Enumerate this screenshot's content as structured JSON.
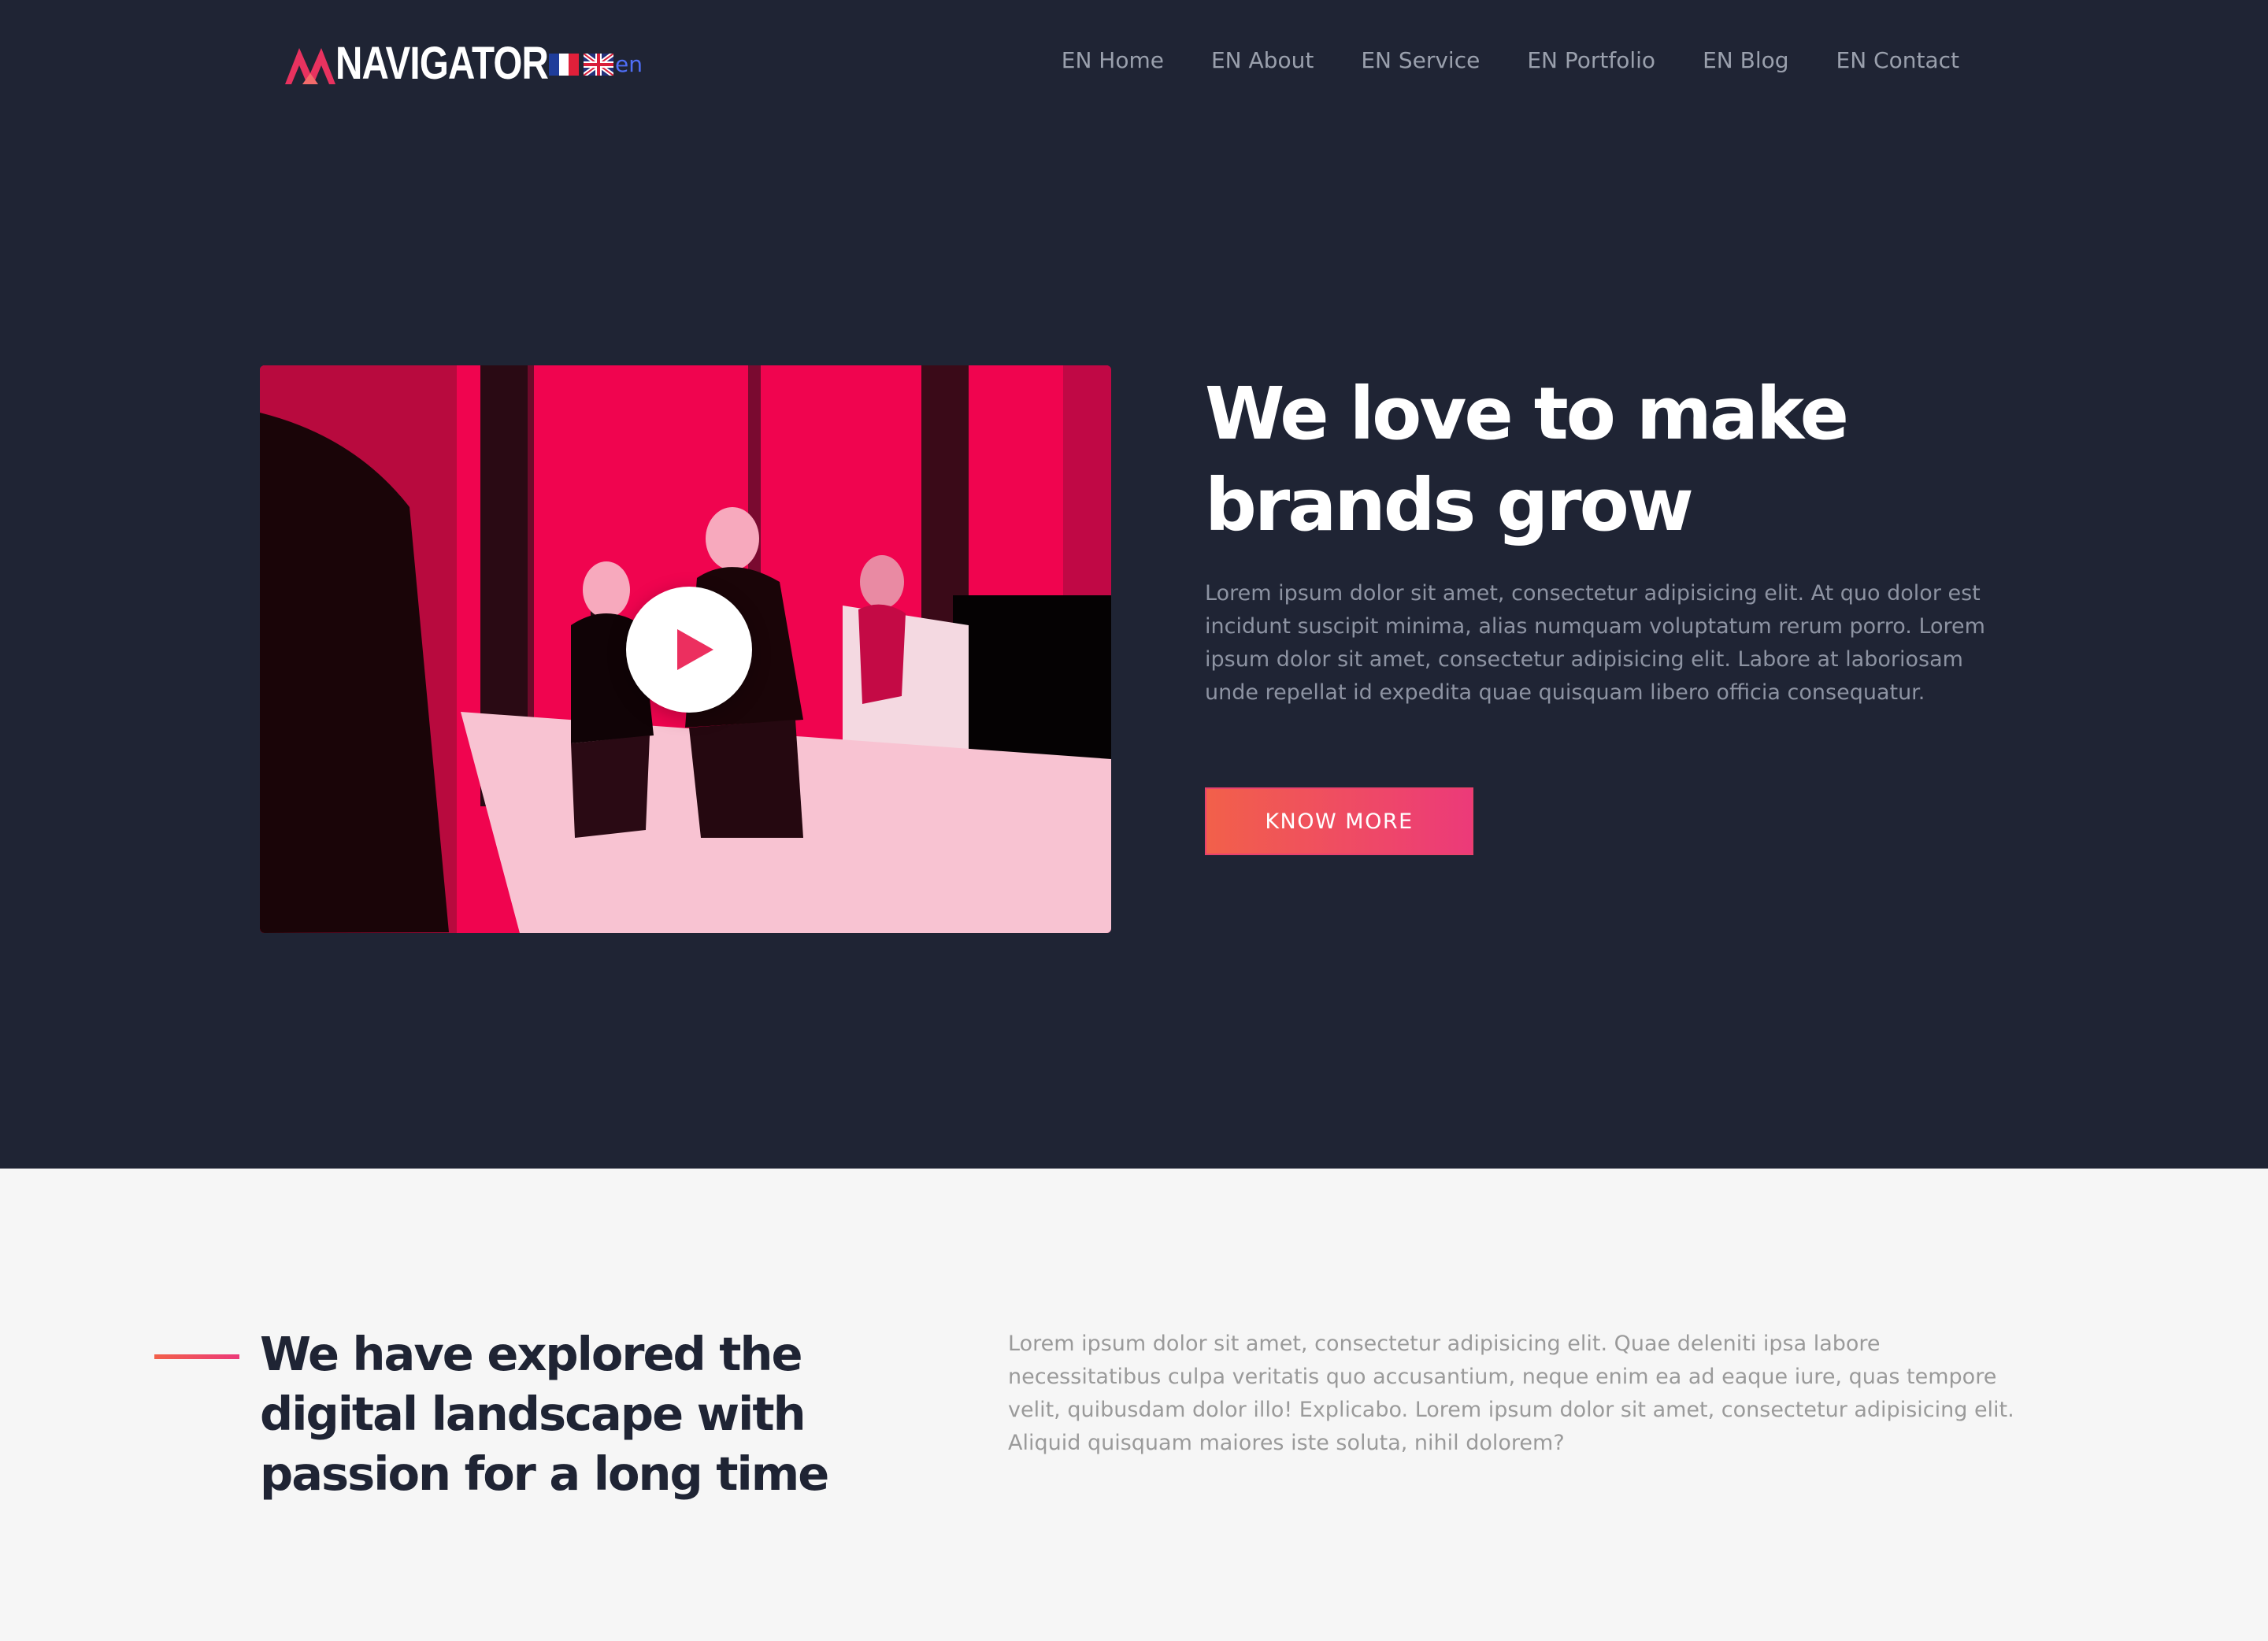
{
  "brand": {
    "name": "NAVIGATOR",
    "accent_color": "#ec2f5f",
    "logo_icon": "navigator-logo-icon"
  },
  "language": {
    "flags": [
      "french-flag-icon",
      "uk-flag-icon"
    ],
    "current": "en"
  },
  "nav": {
    "items": [
      {
        "label": "EN Home"
      },
      {
        "label": "EN About"
      },
      {
        "label": "EN Service"
      },
      {
        "label": "EN Portfolio"
      },
      {
        "label": "EN Blog"
      },
      {
        "label": "EN Contact"
      }
    ]
  },
  "hero": {
    "title": "We love to make brands grow",
    "text": "Lorem ipsum dolor sit amet, consectetur adipisicing elit. At quo dolor est incidunt suscipit minima, alias numquam voluptatum rerum porro. Lorem ipsum dolor sit amet, consectetur adipisicing elit. Labore at laboriosam unde repellat id expedita quae quisquam libero officia consequatur.",
    "cta_label": "KNOW MORE",
    "video_icon": "play-icon",
    "background_color": "#1f2434",
    "video_tint": "#f0044f"
  },
  "about": {
    "title": "We have explored the digital landscape with passion for a long time",
    "text": "Lorem ipsum dolor sit amet, consectetur adipisicing elit. Quae deleniti ipsa labore necessitatibus culpa veritatis quo accusantium, neque enim ea ad eaque iure, quas tempore velit, quibusdam dolor illo! Explicabo. Lorem ipsum dolor sit amet, consectetur adipisicing elit. Aliquid quisquam maiores iste soluta, nihil dolorem?",
    "background_color": "#f6f6f6"
  }
}
